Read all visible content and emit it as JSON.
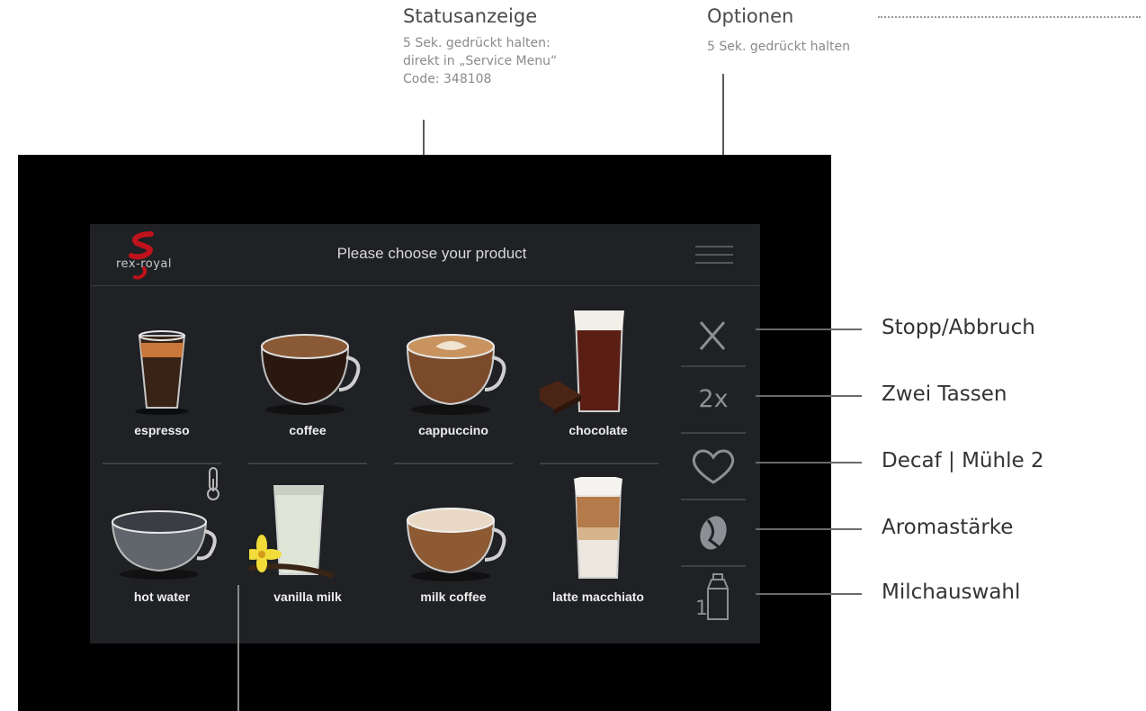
{
  "annotations": {
    "status": {
      "title": "Statusanzeige",
      "sub": "5 Sek. gedrückt halten:\ndirekt in „Service Menu“\nCode: 348108"
    },
    "options": {
      "title": "Optionen",
      "sub": "5 Sek. gedrückt halten"
    },
    "side_labels": {
      "stop": "Stopp/Abbruch",
      "two_cups": "Zwei Tassen",
      "decaf": "Decaf | Mühle 2",
      "aroma": "Aromastärke",
      "milk": "Milchauswahl"
    }
  },
  "screen": {
    "logo_text": "rex-royal",
    "title": "Please choose your product"
  },
  "products": [
    {
      "label": "espresso"
    },
    {
      "label": "coffee"
    },
    {
      "label": "cappuccino"
    },
    {
      "label": "chocolate"
    },
    {
      "label": "hot water"
    },
    {
      "label": "vanilla milk"
    },
    {
      "label": "milk coffee"
    },
    {
      "label": "latte macchiato"
    }
  ],
  "sidebar": {
    "two_cups_label": "2x",
    "milk_number": "1"
  },
  "colors": {
    "screen_bg": "#1f2124",
    "device_bg": "#000000",
    "logo_red": "#c0121c",
    "icon_gray": "#8c8f94"
  }
}
